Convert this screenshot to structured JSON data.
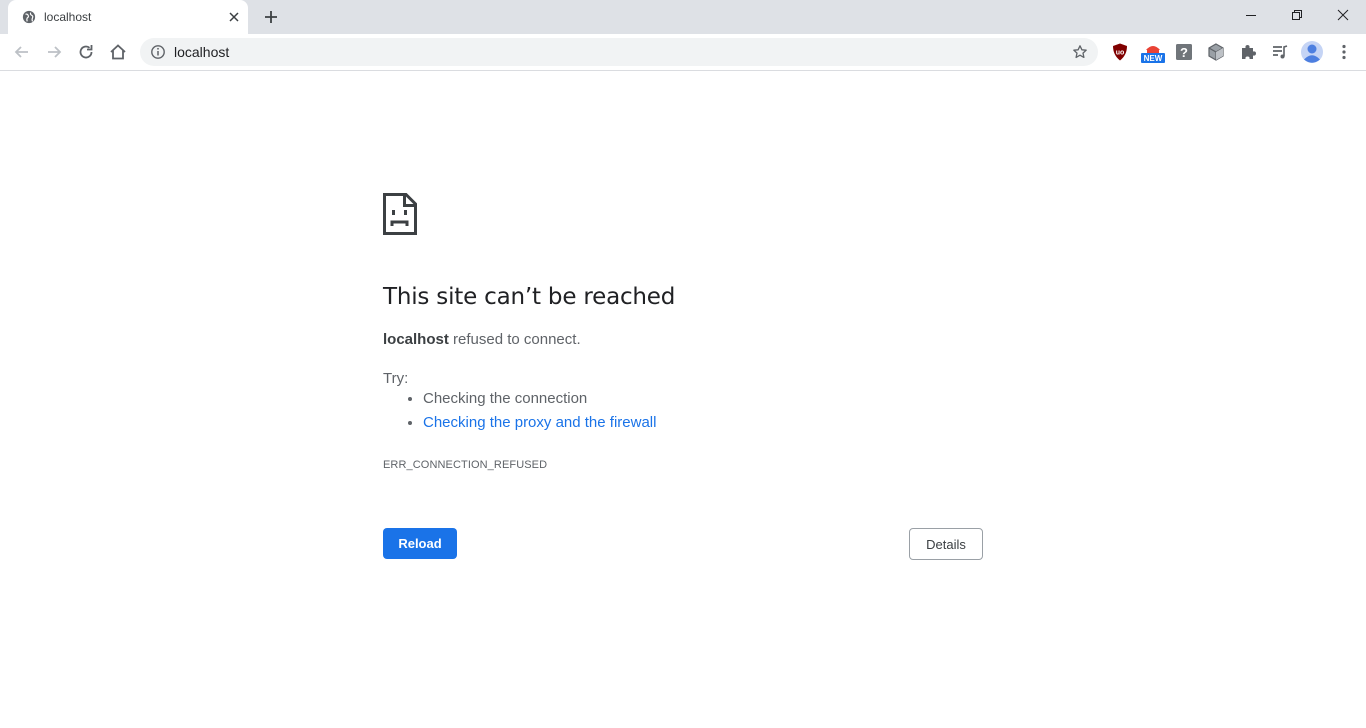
{
  "tab": {
    "title": "localhost",
    "favicon": "globe-icon"
  },
  "omnibox": {
    "url": "localhost"
  },
  "extensions": [
    "ublock-icon",
    "new-badge-extension-icon",
    "help-icon",
    "cube-icon",
    "extensions-puzzle-icon",
    "media-queue-icon",
    "profile-avatar-icon"
  ],
  "error": {
    "heading": "This site can’t be reached",
    "host": "localhost",
    "summary_suffix": " refused to connect.",
    "try_label": "Try:",
    "suggestions": [
      "Checking the connection",
      "Checking the proxy and the firewall"
    ],
    "code": "ERR_CONNECTION_REFUSED",
    "reload_label": "Reload",
    "details_label": "Details"
  },
  "colors": {
    "accent": "#1a73e8",
    "tabstrip": "#dee1e6",
    "text": "#202124",
    "muted": "#5f6368"
  }
}
